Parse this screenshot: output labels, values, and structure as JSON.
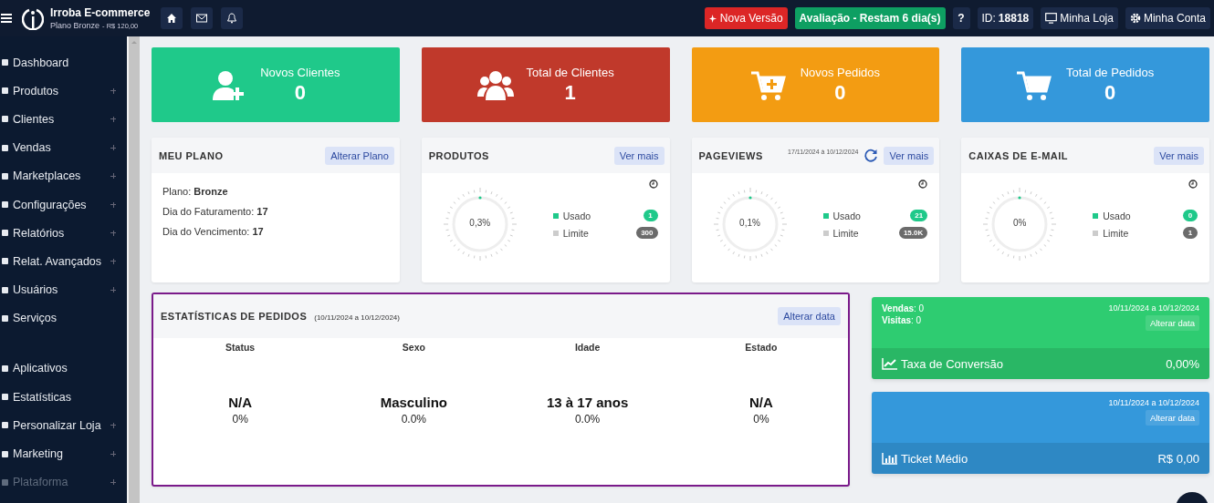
{
  "topbar": {
    "brand": "Irroba E-commerce",
    "plan": "Plano Bronze",
    "price": "- R$ 120,00",
    "new_version": "Nova Versão",
    "trial": "Avaliação - Restam 6 dia(s)",
    "help": "?",
    "id_label": "ID:",
    "id_value": "18818",
    "store": "Minha Loja",
    "account": "Minha Conta"
  },
  "sidebar": {
    "sections": [
      [
        {
          "label": "Dashboard",
          "expandable": false,
          "disabled": false
        },
        {
          "label": "Produtos",
          "expandable": true,
          "disabled": false
        },
        {
          "label": "Clientes",
          "expandable": true,
          "disabled": false
        },
        {
          "label": "Vendas",
          "expandable": true,
          "disabled": false
        },
        {
          "label": "Marketplaces",
          "expandable": true,
          "disabled": false
        },
        {
          "label": "Configurações",
          "expandable": true,
          "disabled": false
        },
        {
          "label": "Relatórios",
          "expandable": true,
          "disabled": false
        },
        {
          "label": "Relat. Avançados",
          "expandable": true,
          "disabled": false
        },
        {
          "label": "Usuários",
          "expandable": true,
          "disabled": false
        },
        {
          "label": "Serviços",
          "expandable": false,
          "disabled": false
        }
      ],
      [
        {
          "label": "Aplicativos",
          "expandable": false,
          "disabled": false
        },
        {
          "label": "Estatísticas",
          "expandable": false,
          "disabled": false
        },
        {
          "label": "Personalizar Loja",
          "expandable": true,
          "disabled": false
        },
        {
          "label": "Marketing",
          "expandable": true,
          "disabled": false
        },
        {
          "label": "Plataforma",
          "expandable": true,
          "disabled": true
        }
      ]
    ]
  },
  "summary_cards": [
    {
      "kind": "user-plus",
      "label": "Novos Clientes",
      "value": "0",
      "color": "#1fc98a"
    },
    {
      "kind": "users",
      "label": "Total de Clientes",
      "value": "1",
      "color": "#c0392b"
    },
    {
      "kind": "cart-plus",
      "label": "Novos Pedidos",
      "value": "0",
      "color": "#f39c12"
    },
    {
      "kind": "cart",
      "label": "Total de Pedidos",
      "value": "0",
      "color": "#3498db"
    }
  ],
  "plan_card": {
    "title": "MEU PLANO",
    "button": "Alterar Plano",
    "lines": [
      "Plano: **Bronze**",
      "Dia do Faturamento: **17**",
      "Dia do Vencimento: **17**"
    ]
  },
  "usage_cards": [
    {
      "title": "PRODUTOS",
      "button": "Ver mais",
      "reading": "0,3%",
      "used_label": "Usado",
      "used": "1",
      "limit_label": "Limite",
      "limit": "300"
    },
    {
      "title": "PAGEVIEWS",
      "range": "17/11/2024 à 10/12/2024",
      "refresh": true,
      "button": "Ver mais",
      "reading": "0,1%",
      "used_label": "Usado",
      "used": "21",
      "limit_label": "Limite",
      "limit": "15.0K"
    },
    {
      "title": "CAIXAS DE E-MAIL",
      "button": "Ver mais",
      "reading": "0%",
      "used_label": "Usado",
      "used": "0",
      "limit_label": "Limite",
      "limit": "1"
    }
  ],
  "order_stats": {
    "title": "ESTATÍSTICAS DE PEDIDOS",
    "range": "(10/11/2024 a 10/12/2024)",
    "button": "Alterar data",
    "selected": true,
    "columns": [
      {
        "label": "Status",
        "value": "N/A",
        "percent": "0%"
      },
      {
        "label": "Sexo",
        "value": "Masculino",
        "percent": "0.0%"
      },
      {
        "label": "Idade",
        "value": "13 à 17 anos",
        "percent": "0.0%"
      },
      {
        "label": "Estado",
        "value": "N/A",
        "percent": "0%"
      }
    ]
  },
  "metric_panels": [
    {
      "color": "#2ecc71",
      "lines": [
        "**Vendas**: 0",
        "**Visitas**: 0"
      ],
      "range": "10/11/2024 a 10/12/2024",
      "button": "Alterar data",
      "kind": "line",
      "label": "Taxa de Conversão",
      "value": "0,00%"
    },
    {
      "color": "#3498db",
      "range": "10/11/2024 a 10/12/2024",
      "button": "Alterar data",
      "kind": "bar",
      "label": "Ticket Médio",
      "value": "R$ 0,00"
    }
  ]
}
